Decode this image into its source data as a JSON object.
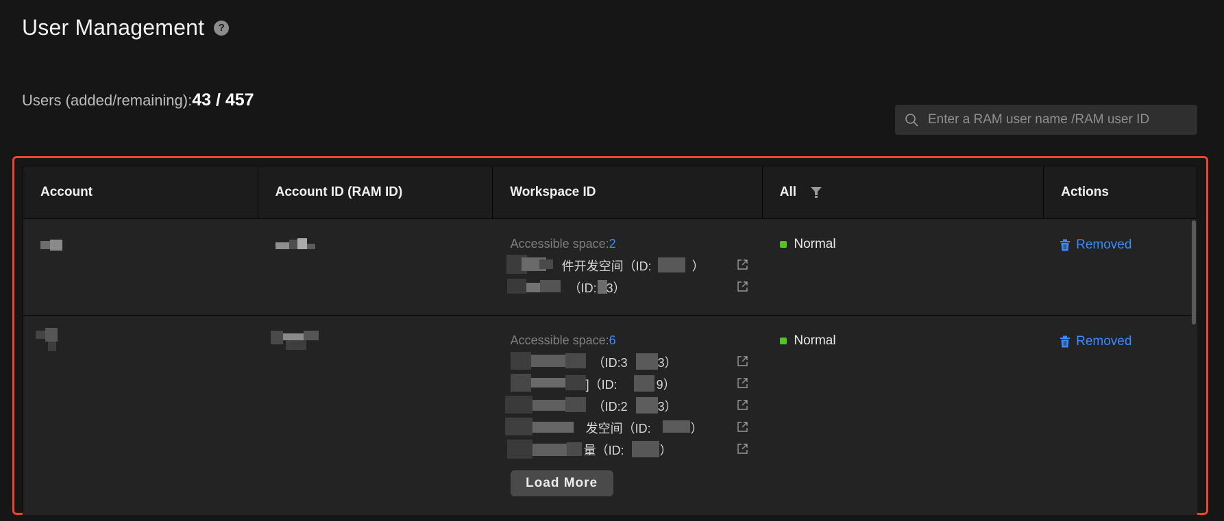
{
  "header": {
    "title": "User Management",
    "help_glyph": "?",
    "help_icon": "question-circle-icon"
  },
  "summary": {
    "label": "Users (added/remaining):",
    "value": "43 / 457"
  },
  "search": {
    "placeholder": "Enter a RAM user name /RAM user ID",
    "icon": "search-icon"
  },
  "table": {
    "columns": {
      "account": "Account",
      "account_id": "Account ID (RAM ID)",
      "workspace_id": "Workspace ID",
      "status_filter": "All",
      "actions": "Actions"
    },
    "rows": [
      {
        "account": "",
        "account_id": "",
        "accessible_label": "Accessible space:",
        "accessible_count": "2",
        "workspaces": [
          {
            "prefix": "",
            "visible_text": "件开发空间（ID:",
            "suffix": "）"
          },
          {
            "prefix": "",
            "visible_text": "（ID:",
            "suffix": "3）"
          }
        ],
        "status": "Normal",
        "action": "Removed"
      },
      {
        "account": "",
        "account_id": "",
        "accessible_label": "Accessible space:",
        "accessible_count": "6",
        "workspaces": [
          {
            "prefix": "",
            "visible_text": "（ID:3",
            "suffix": "3）"
          },
          {
            "prefix": "",
            "visible_text": "]（ID:",
            "suffix": "9）"
          },
          {
            "prefix": "",
            "visible_text": "（ID:2",
            "suffix": "3）"
          },
          {
            "prefix": "",
            "visible_text": "发空间（ID:",
            "suffix": "）"
          },
          {
            "prefix": "",
            "visible_text": "量（ID:",
            "suffix": "）"
          }
        ],
        "status": "Normal",
        "action": "Removed",
        "load_more": "Load More"
      }
    ]
  },
  "colors": {
    "accent": "#3a8bff",
    "status_normal": "#52c41a",
    "highlight": "#e8492b",
    "background": "#161616"
  }
}
